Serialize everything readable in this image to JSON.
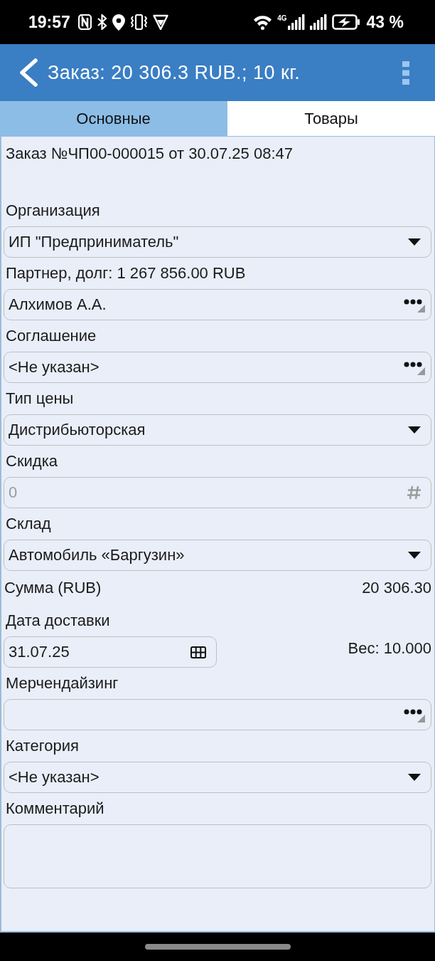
{
  "status_bar": {
    "time": "19:57",
    "network": "4G",
    "battery": "43 %"
  },
  "app_bar": {
    "title": "Заказ: 20 306.3 RUB.; 10 кг."
  },
  "tabs": [
    {
      "label": "Основные",
      "selected": true
    },
    {
      "label": "Товары",
      "selected": false
    }
  ],
  "form": {
    "heading": "Заказ №ЧП00-000015 от 30.07.25 08:47",
    "items": [
      {
        "kind": "dropdown",
        "label": "Организация",
        "value": "ИП \"Предприниматель\""
      },
      {
        "kind": "picker",
        "label": "Партнер, долг: 1 267 856.00 RUB",
        "value": "Алхимов А.А."
      },
      {
        "kind": "picker",
        "label": "Соглашение",
        "value": "<Не указан>"
      },
      {
        "kind": "dropdown",
        "label": "Тип цены",
        "value": "Дистрибьюторская"
      },
      {
        "kind": "number",
        "label": "Скидка",
        "placeholder": "0"
      },
      {
        "kind": "dropdown",
        "label": "Склад",
        "value": "Автомобиль «Баргузин»"
      },
      {
        "kind": "total",
        "label": "Сумма (RUB)",
        "value": "20 306.30"
      },
      {
        "kind": "date",
        "label": "Дата доставки",
        "value": "31.07.25",
        "note": "Вес: 10.000"
      },
      {
        "kind": "picker",
        "label": "Мерчендайзинг"
      },
      {
        "kind": "dropdown",
        "label": "Категория",
        "value": "<Не указан>"
      },
      {
        "kind": "memo",
        "label": "Комментарий"
      }
    ]
  }
}
